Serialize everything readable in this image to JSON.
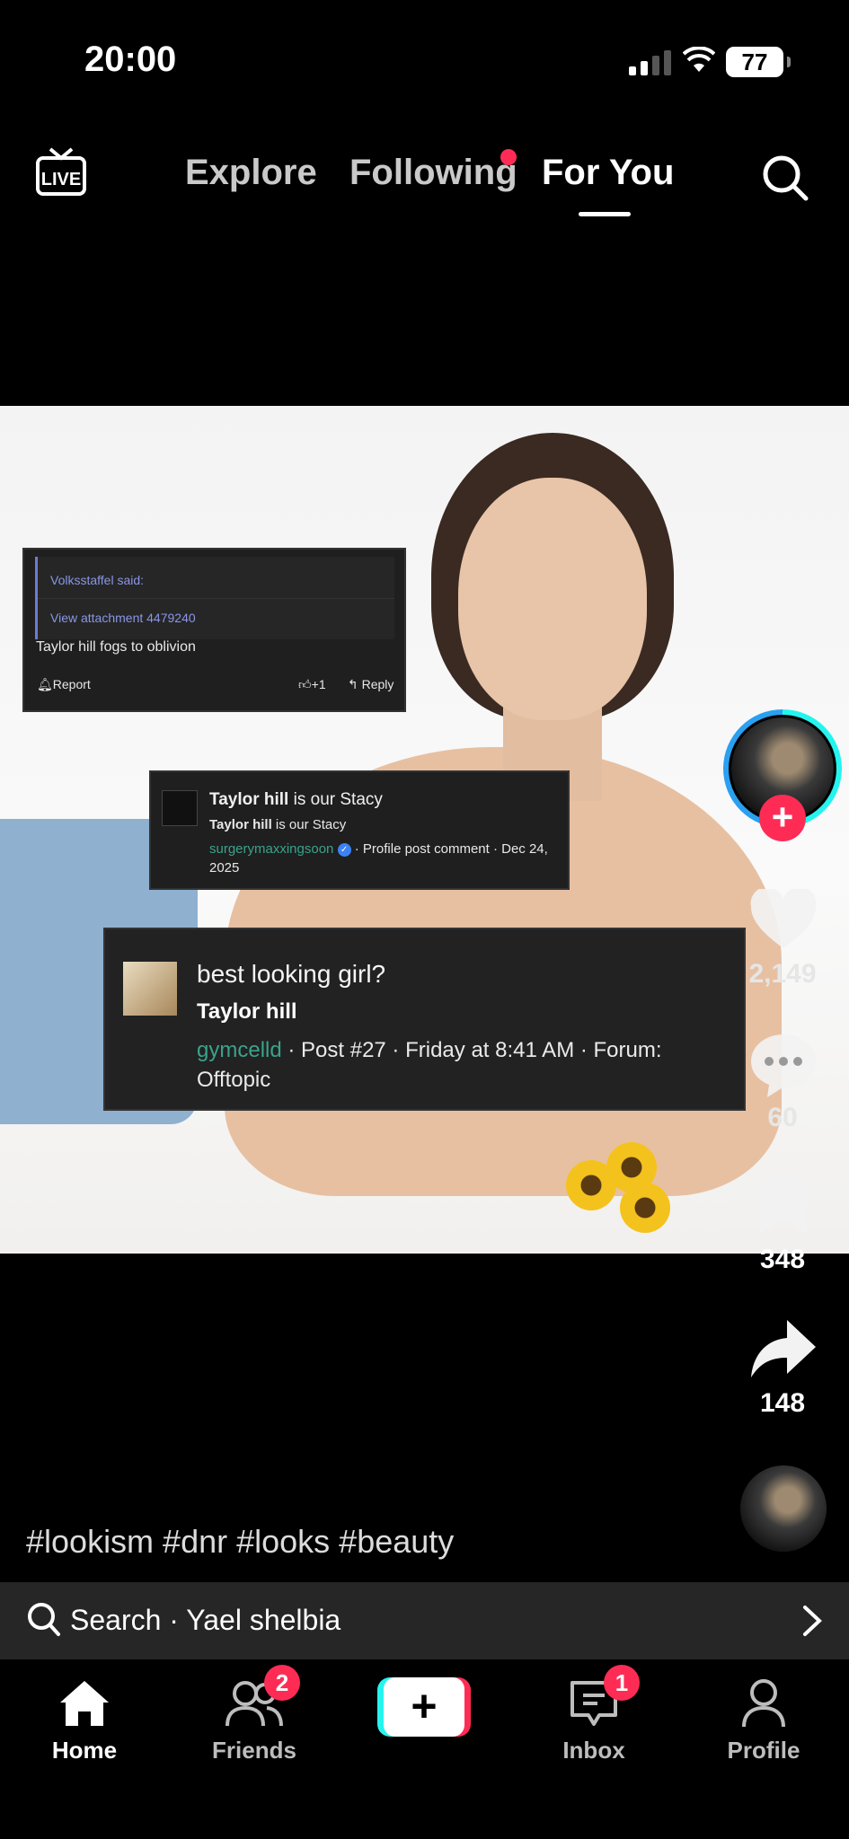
{
  "status_bar": {
    "time": "20:00",
    "battery": "77"
  },
  "top_nav": {
    "live_label": "LIVE",
    "tabs": [
      {
        "label": "Explore"
      },
      {
        "label": "Following"
      },
      {
        "label": "For You"
      }
    ]
  },
  "overlays": {
    "card1": {
      "quote_author": "Volksstaffel said:",
      "quote_attachment": "View attachment 4479240",
      "text": "Taylor hill fogs to oblivion",
      "report": "Report",
      "like": "+1",
      "reply": "Reply"
    },
    "card2": {
      "title_bold": "Taylor hill",
      "title_rest": " is our Stacy",
      "sub_bold": "Taylor hill",
      "sub_rest": " is our Stacy",
      "user": "surgerymaxxingsoon",
      "meta": " · Profile post comment · Dec 24, 2025"
    },
    "card3": {
      "title": "best looking girl?",
      "subtitle": "Taylor hill",
      "user": "gymcelld",
      "meta": " · Post #27 · Friday at 8:41 AM · Forum: Offtopic"
    }
  },
  "actions": {
    "likes": "2,149",
    "comments": "60",
    "saves": "348",
    "shares": "148"
  },
  "caption": {
    "hashtags": "#lookism #dnr #looks #beauty"
  },
  "search_bar": {
    "text": "Search · Yael shelbia"
  },
  "bottom_nav": {
    "home": "Home",
    "friends": "Friends",
    "friends_badge": "2",
    "inbox": "Inbox",
    "inbox_badge": "1",
    "profile": "Profile",
    "create": "+"
  },
  "colors": {
    "accent_red": "#fe2c55",
    "accent_cyan": "#25f4ee",
    "forum_user": "#3aa38b"
  }
}
